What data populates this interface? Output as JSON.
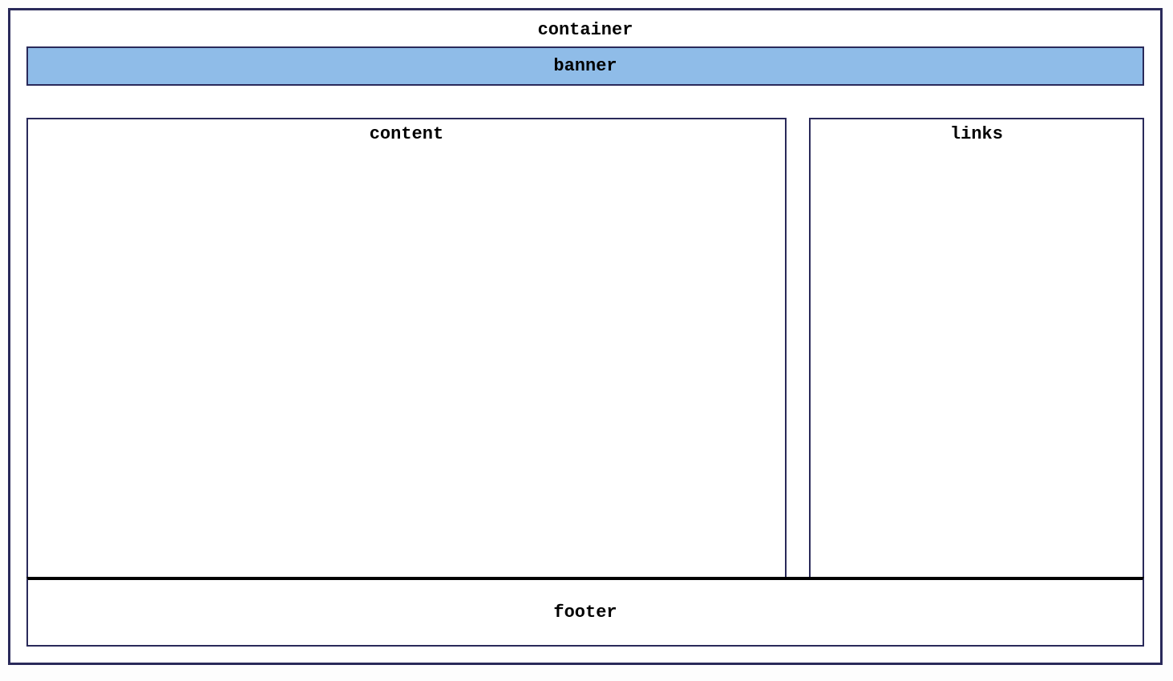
{
  "labels": {
    "container": "container",
    "banner": "banner",
    "content": "content",
    "links": "links",
    "footer": "footer"
  },
  "colors": {
    "banner_bg": "#8fbce8",
    "border": "#2a2a5a",
    "box_bg": "#ffffff"
  }
}
